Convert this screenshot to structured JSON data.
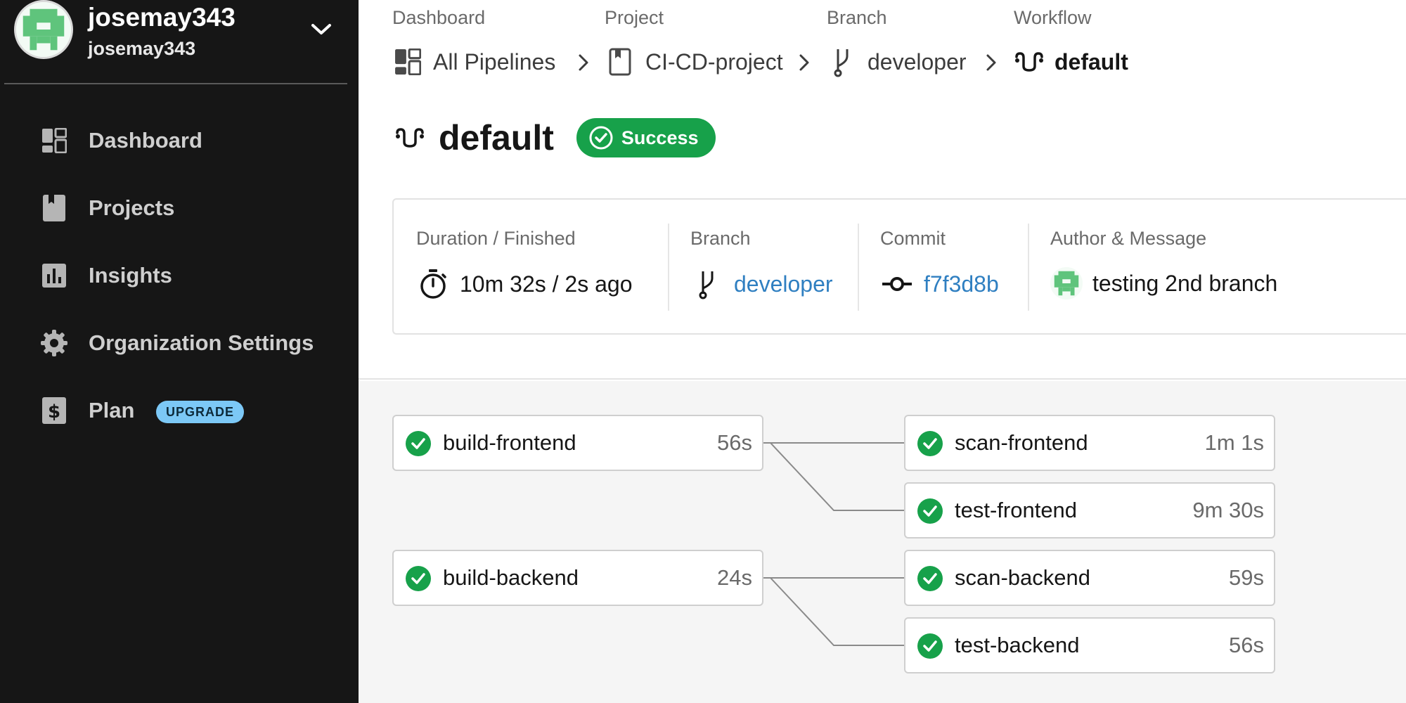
{
  "user": {
    "name": "josemay343",
    "org": "josemay343",
    "avatar_icon": "identicon-avatar"
  },
  "sidebar": {
    "items": [
      {
        "label": "Dashboard",
        "icon": "dashboard-icon"
      },
      {
        "label": "Projects",
        "icon": "project-icon"
      },
      {
        "label": "Insights",
        "icon": "insights-icon"
      },
      {
        "label": "Organization Settings",
        "icon": "gear-icon"
      },
      {
        "label": "Plan",
        "icon": "dollar-icon",
        "badge": "UPGRADE"
      }
    ]
  },
  "breadcrumb": [
    {
      "caption": "Dashboard",
      "label": "All Pipelines",
      "icon": "dashboard-icon"
    },
    {
      "caption": "Project",
      "label": "CI-CD-project",
      "icon": "project-icon"
    },
    {
      "caption": "Branch",
      "label": "developer",
      "icon": "branch-icon"
    },
    {
      "caption": "Workflow",
      "label": "default",
      "icon": "workflow-icon"
    }
  ],
  "workflow": {
    "title": "default",
    "status": "Success",
    "status_color": "#17a14a"
  },
  "meta": {
    "duration": {
      "caption": "Duration / Finished",
      "value": "10m 32s / 2s ago"
    },
    "branch": {
      "caption": "Branch",
      "value": "developer"
    },
    "commit": {
      "caption": "Commit",
      "value": "f7f3d8b"
    },
    "author": {
      "caption": "Author & Message",
      "value": "testing 2nd branch"
    }
  },
  "jobs": [
    {
      "name": "build-frontend",
      "duration": "56s",
      "status": "success"
    },
    {
      "name": "scan-frontend",
      "duration": "1m 1s",
      "status": "success"
    },
    {
      "name": "test-frontend",
      "duration": "9m 30s",
      "status": "success"
    },
    {
      "name": "build-backend",
      "duration": "24s",
      "status": "success"
    },
    {
      "name": "scan-backend",
      "duration": "59s",
      "status": "success"
    },
    {
      "name": "test-backend",
      "duration": "56s",
      "status": "success"
    }
  ],
  "colors": {
    "sidebar_bg": "#161616",
    "success": "#17a14a",
    "link": "#2f7fc1",
    "badge": "#7cc8f6"
  }
}
